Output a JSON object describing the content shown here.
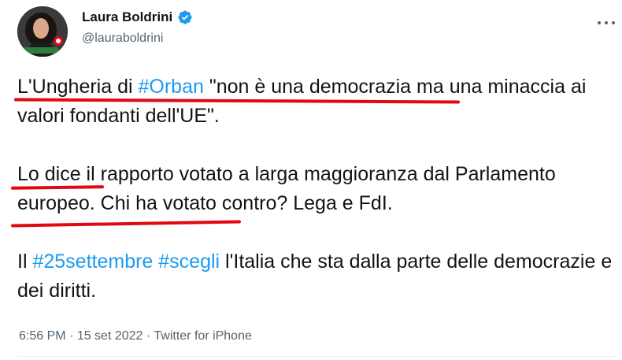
{
  "author": {
    "name": "Laura Boldrini",
    "handle": "@lauraboldrini",
    "verified": true,
    "avatar_icon": "profile-photo"
  },
  "tweet": {
    "p1": {
      "t1": "L'Ungheria di ",
      "tag": "#Orban",
      "t2": " \"non è una democrazia ma una minaccia ai valori fondanti dell'UE\"."
    },
    "p2": {
      "t1": "Lo dice il rapporto votato a larga maggioranza dal Parlamento europeo. Chi ha votato contro? Lega e FdI."
    },
    "p3": {
      "t1": "Il ",
      "tag1": "#25settembre",
      "t2": " ",
      "tag2": "#scegli",
      "t3": " l'Italia che sta dalla parte delle democrazie e dei diritti."
    }
  },
  "meta": {
    "time": "6:56 PM",
    "sep1": " · ",
    "date": "15 set 2022",
    "sep2": " · ",
    "source": "Twitter for iPhone"
  },
  "colors": {
    "link": "#1d9bf0",
    "underline": "#e30613",
    "verified": "#1d9bf0"
  }
}
